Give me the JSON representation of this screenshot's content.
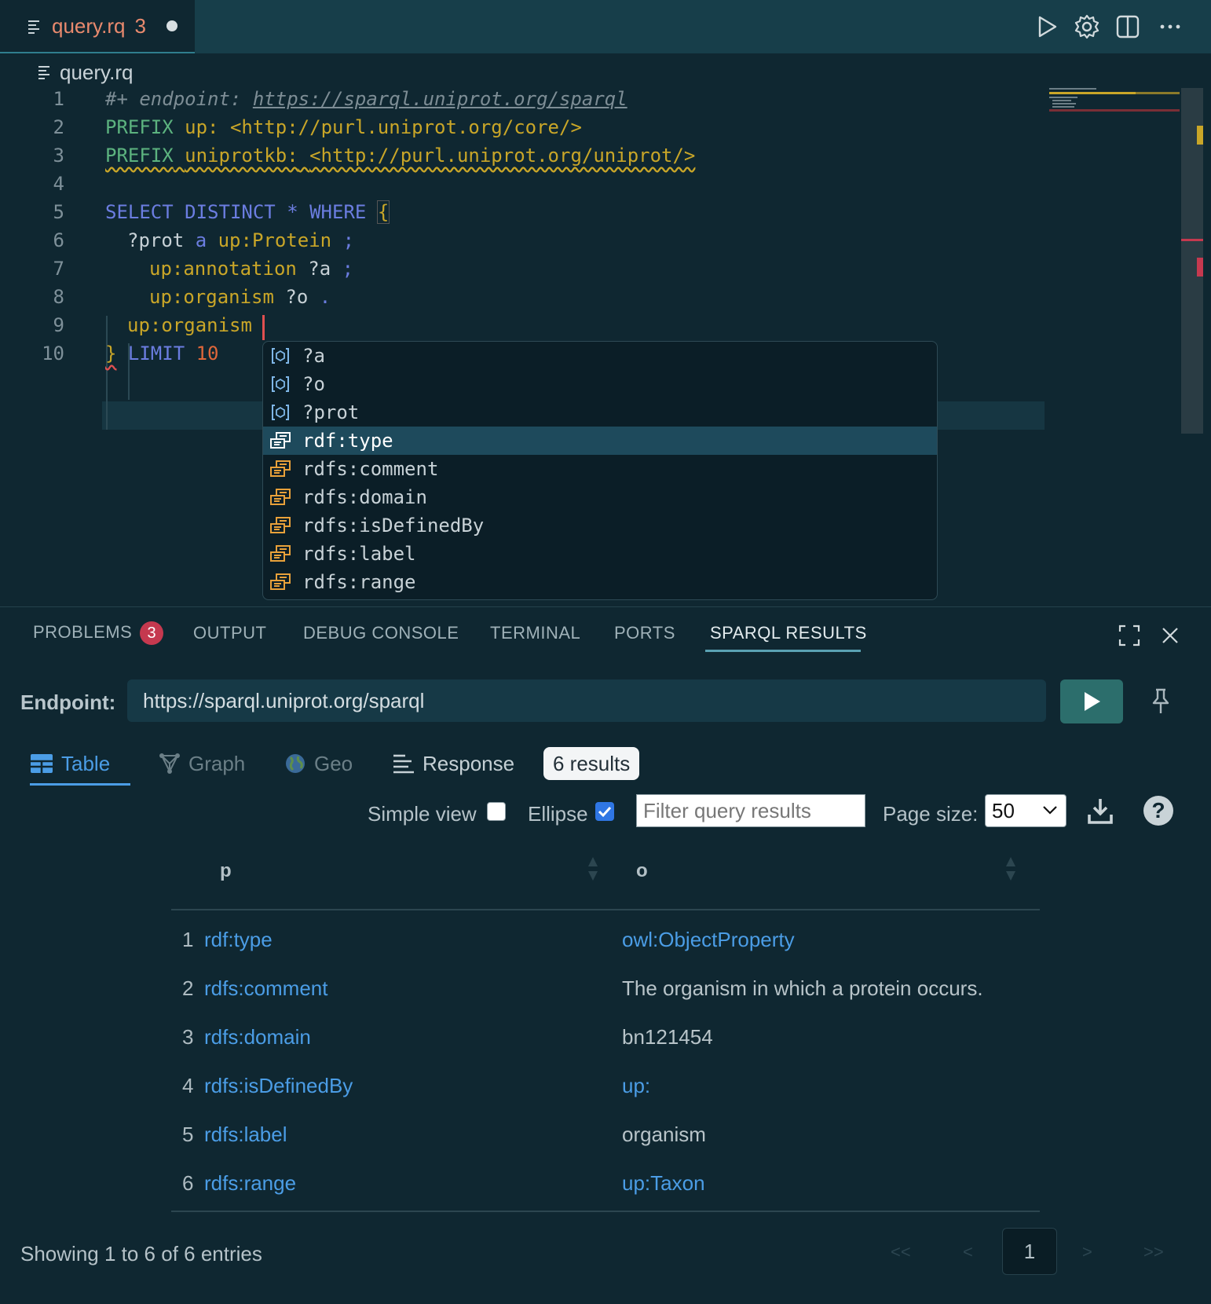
{
  "tab": {
    "name": "query.rq",
    "problems": "3"
  },
  "breadcrumb": {
    "file": "query.rq"
  },
  "editor": {
    "line_numbers": [
      "1",
      "2",
      "3",
      "4",
      "5",
      "6",
      "7",
      "8",
      "9",
      "10"
    ],
    "l1_comment": "#+ endpoint: ",
    "l1_url": "https://sparql.uniprot.org/sparql",
    "l2_kw": "PREFIX",
    "l2_prefix": "up:",
    "l2_iri": "<http://purl.uniprot.org/core/>",
    "l3_kw": "PREFIX",
    "l3_prefix": "uniprotkb:",
    "l3_iri": "<http://purl.uniprot.org/uniprot/>",
    "l5_select": "SELECT DISTINCT",
    "l5_star": "*",
    "l5_where": "WHERE",
    "l5_brace": "{",
    "l6_var": "?prot",
    "l6_a": "a",
    "l6_class": "up:Protein",
    "l6_sep": ";",
    "l7_pred": "up:annotation",
    "l7_var": "?a",
    "l7_sep": ";",
    "l8_pred": "up:organism",
    "l8_var": "?o",
    "l8_sep": ".",
    "l9_pred": "up:organism",
    "l10_brace": "}",
    "l10_limit": "LIMIT",
    "l10_num": "10"
  },
  "suggest": {
    "items": [
      {
        "label": "?a",
        "kind": "variable"
      },
      {
        "label": "?o",
        "kind": "variable"
      },
      {
        "label": "?prot",
        "kind": "variable"
      },
      {
        "label": "rdf:type",
        "kind": "property",
        "selected": true
      },
      {
        "label": "rdfs:comment",
        "kind": "property"
      },
      {
        "label": "rdfs:domain",
        "kind": "property"
      },
      {
        "label": "rdfs:isDefinedBy",
        "kind": "property"
      },
      {
        "label": "rdfs:label",
        "kind": "property"
      },
      {
        "label": "rdfs:range",
        "kind": "property"
      }
    ]
  },
  "panel": {
    "tabs": {
      "problems": "PROBLEMS",
      "problems_count": "3",
      "output": "OUTPUT",
      "debug": "DEBUG CONSOLE",
      "terminal": "TERMINAL",
      "ports": "PORTS",
      "sparql": "SPARQL RESULTS"
    },
    "endpoint_label": "Endpoint:",
    "endpoint_value": "https://sparql.uniprot.org/sparql",
    "views": {
      "table": "Table",
      "graph": "Graph",
      "geo": "Geo",
      "response": "Response"
    },
    "results_count": "6 results",
    "simple_view": "Simple view",
    "ellipse": "Ellipse",
    "filter_placeholder": "Filter query results",
    "page_size_label": "Page size:",
    "page_size": "50",
    "help": "?",
    "columns": [
      "p",
      "o"
    ],
    "rows": [
      {
        "n": "1",
        "p": "rdf:type",
        "o": "owl:ObjectProperty",
        "o_link": true
      },
      {
        "n": "2",
        "p": "rdfs:comment",
        "o": "The organism in which a protein occurs.",
        "o_link": false
      },
      {
        "n": "3",
        "p": "rdfs:domain",
        "o": "bn121454",
        "o_link": false
      },
      {
        "n": "4",
        "p": "rdfs:isDefinedBy",
        "o": "up:",
        "o_link": true
      },
      {
        "n": "5",
        "p": "rdfs:label",
        "o": "organism",
        "o_link": false
      },
      {
        "n": "6",
        "p": "rdfs:range",
        "o": "up:Taxon",
        "o_link": true
      }
    ],
    "showing": "Showing 1 to 6 of 6 entries",
    "pager": {
      "first": "<<",
      "prev": "<",
      "current": "1",
      "next": ">",
      "last": ">>"
    }
  },
  "colors": {
    "accent": "#4b9de6",
    "badge": "#c5394f",
    "run": "#2c6e6c"
  }
}
